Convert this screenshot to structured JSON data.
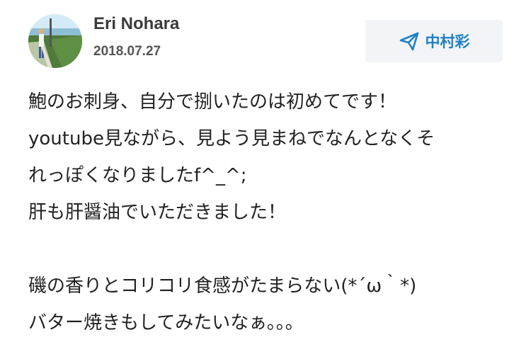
{
  "post": {
    "author": "Eri Nohara",
    "date": "2018.07.27",
    "avatar": "avatar-photo",
    "mention": {
      "label": "中村彩",
      "icon": "send-icon",
      "color": "#1f7fc4"
    },
    "body_lines": [
      "鮑のお刺身、自分で捌いたのは初めてです！",
      "youtube見ながら、見よう見まねでなんとなくそ",
      "れっぽくなりましたf^_^;",
      "肝も肝醤油でいただきました！",
      "",
      "磯の香りとコリコリ食感がたまらない(*´ω｀*)",
      "バター焼きもしてみたいなぁ。。。"
    ]
  }
}
